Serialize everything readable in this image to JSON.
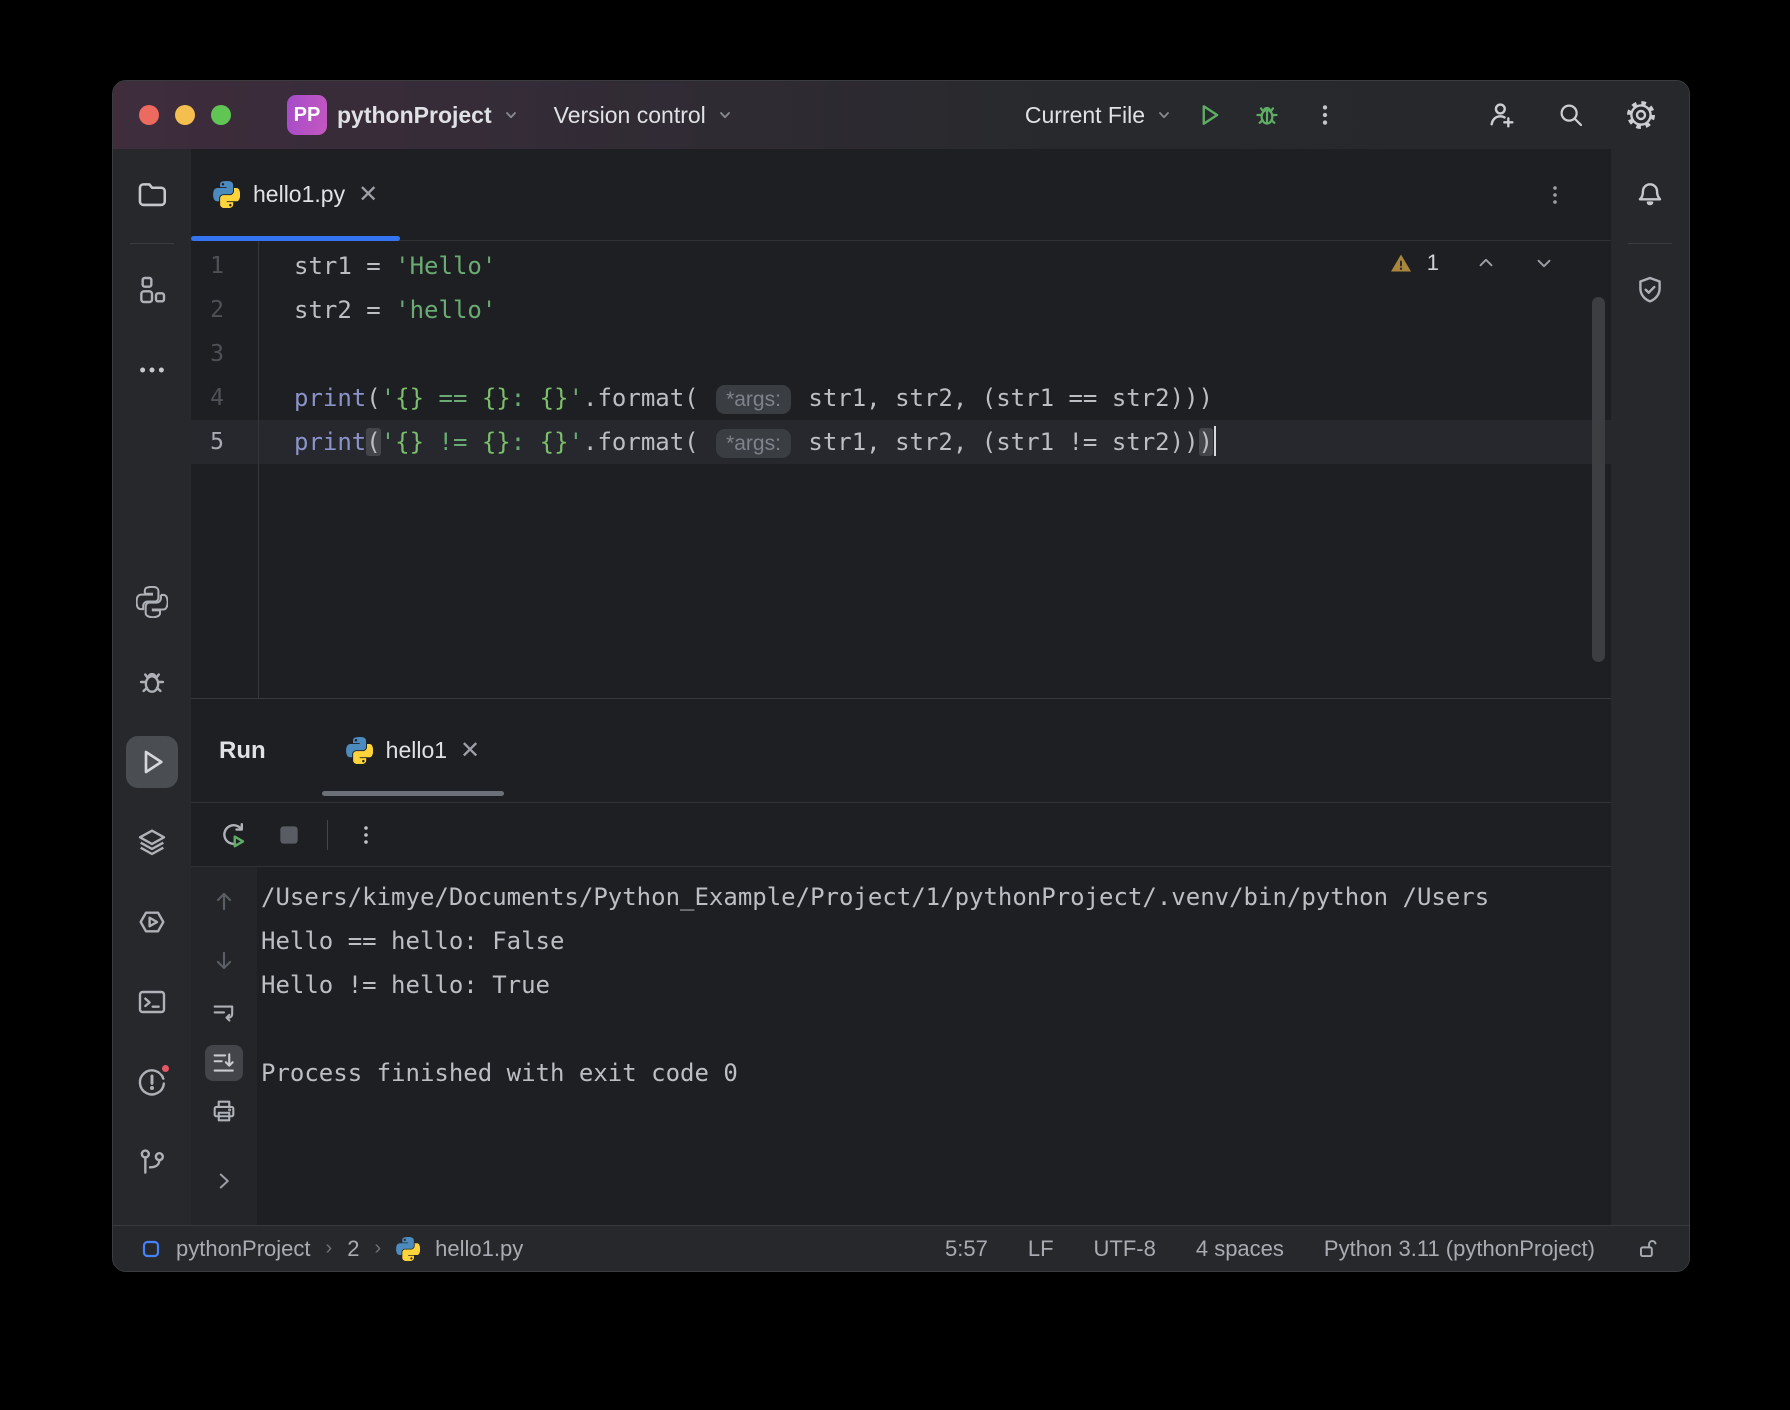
{
  "titlebar": {
    "badge": "PP",
    "project": "pythonProject",
    "vcs": "Version control",
    "run_config": "Current File"
  },
  "editor": {
    "tab": "hello1.py",
    "warning_count": "1",
    "lines": [
      {
        "no": "1",
        "tokens": [
          {
            "t": "str1 = ",
            "c": "plain"
          },
          {
            "t": "'Hello'",
            "c": "string"
          }
        ]
      },
      {
        "no": "2",
        "tokens": [
          {
            "t": "str2 = ",
            "c": "plain"
          },
          {
            "t": "'hello'",
            "c": "string"
          }
        ]
      },
      {
        "no": "3",
        "tokens": []
      },
      {
        "no": "4",
        "tokens": [
          {
            "t": "print",
            "c": "func"
          },
          {
            "t": "(",
            "c": "plain"
          },
          {
            "t": "'",
            "c": "string"
          },
          {
            "t": "{}",
            "c": "brace"
          },
          {
            "t": " == ",
            "c": "string"
          },
          {
            "t": "{}",
            "c": "brace"
          },
          {
            "t": ": ",
            "c": "string"
          },
          {
            "t": "{}",
            "c": "brace"
          },
          {
            "t": "'",
            "c": "string"
          },
          {
            "t": ".format( ",
            "c": "plain"
          },
          {
            "t": "*args:",
            "c": "hint"
          },
          {
            "t": " str1, str2, (str1 == str2)))",
            "c": "plain"
          }
        ]
      },
      {
        "no": "5",
        "current": true,
        "cursor": true,
        "tokens": [
          {
            "t": "print",
            "c": "func"
          },
          {
            "t": "(",
            "c": "plain match"
          },
          {
            "t": "'",
            "c": "string"
          },
          {
            "t": "{}",
            "c": "brace"
          },
          {
            "t": " != ",
            "c": "string"
          },
          {
            "t": "{}",
            "c": "brace"
          },
          {
            "t": ": ",
            "c": "string"
          },
          {
            "t": "{}",
            "c": "brace"
          },
          {
            "t": "'",
            "c": "string"
          },
          {
            "t": ".format( ",
            "c": "plain"
          },
          {
            "t": "*args:",
            "c": "hint"
          },
          {
            "t": " str1, str2, (str1 != str2))",
            "c": "plain"
          },
          {
            "t": ")",
            "c": "plain match"
          }
        ]
      }
    ]
  },
  "run_panel": {
    "title": "Run",
    "tab": "hello1",
    "console_lines": [
      "/Users/kimye/Documents/Python_Example/Project/1/pythonProject/.venv/bin/python /Users",
      "Hello == hello: False",
      "Hello != hello: True",
      "",
      "Process finished with exit code 0"
    ]
  },
  "status_bar": {
    "project": "pythonProject",
    "folder": "2",
    "file": "hello1.py",
    "caret": "5:57",
    "line_ending": "LF",
    "encoding": "UTF-8",
    "indent": "4 spaces",
    "interpreter": "Python 3.11 (pythonProject)"
  },
  "colors": {
    "accent_blue": "#3574F0",
    "run_green": "#5FAD65",
    "warning_gold": "#A8873C",
    "string_green": "#6AAB73",
    "builtin_purple": "#8B93C9",
    "python_blue": "#4B8BBE",
    "python_yellow": "#FFD43B",
    "problem_red": "#E55765",
    "mac_close": "#EC6A5E",
    "mac_minimize": "#F4BF4F",
    "mac_zoom": "#61C554"
  }
}
